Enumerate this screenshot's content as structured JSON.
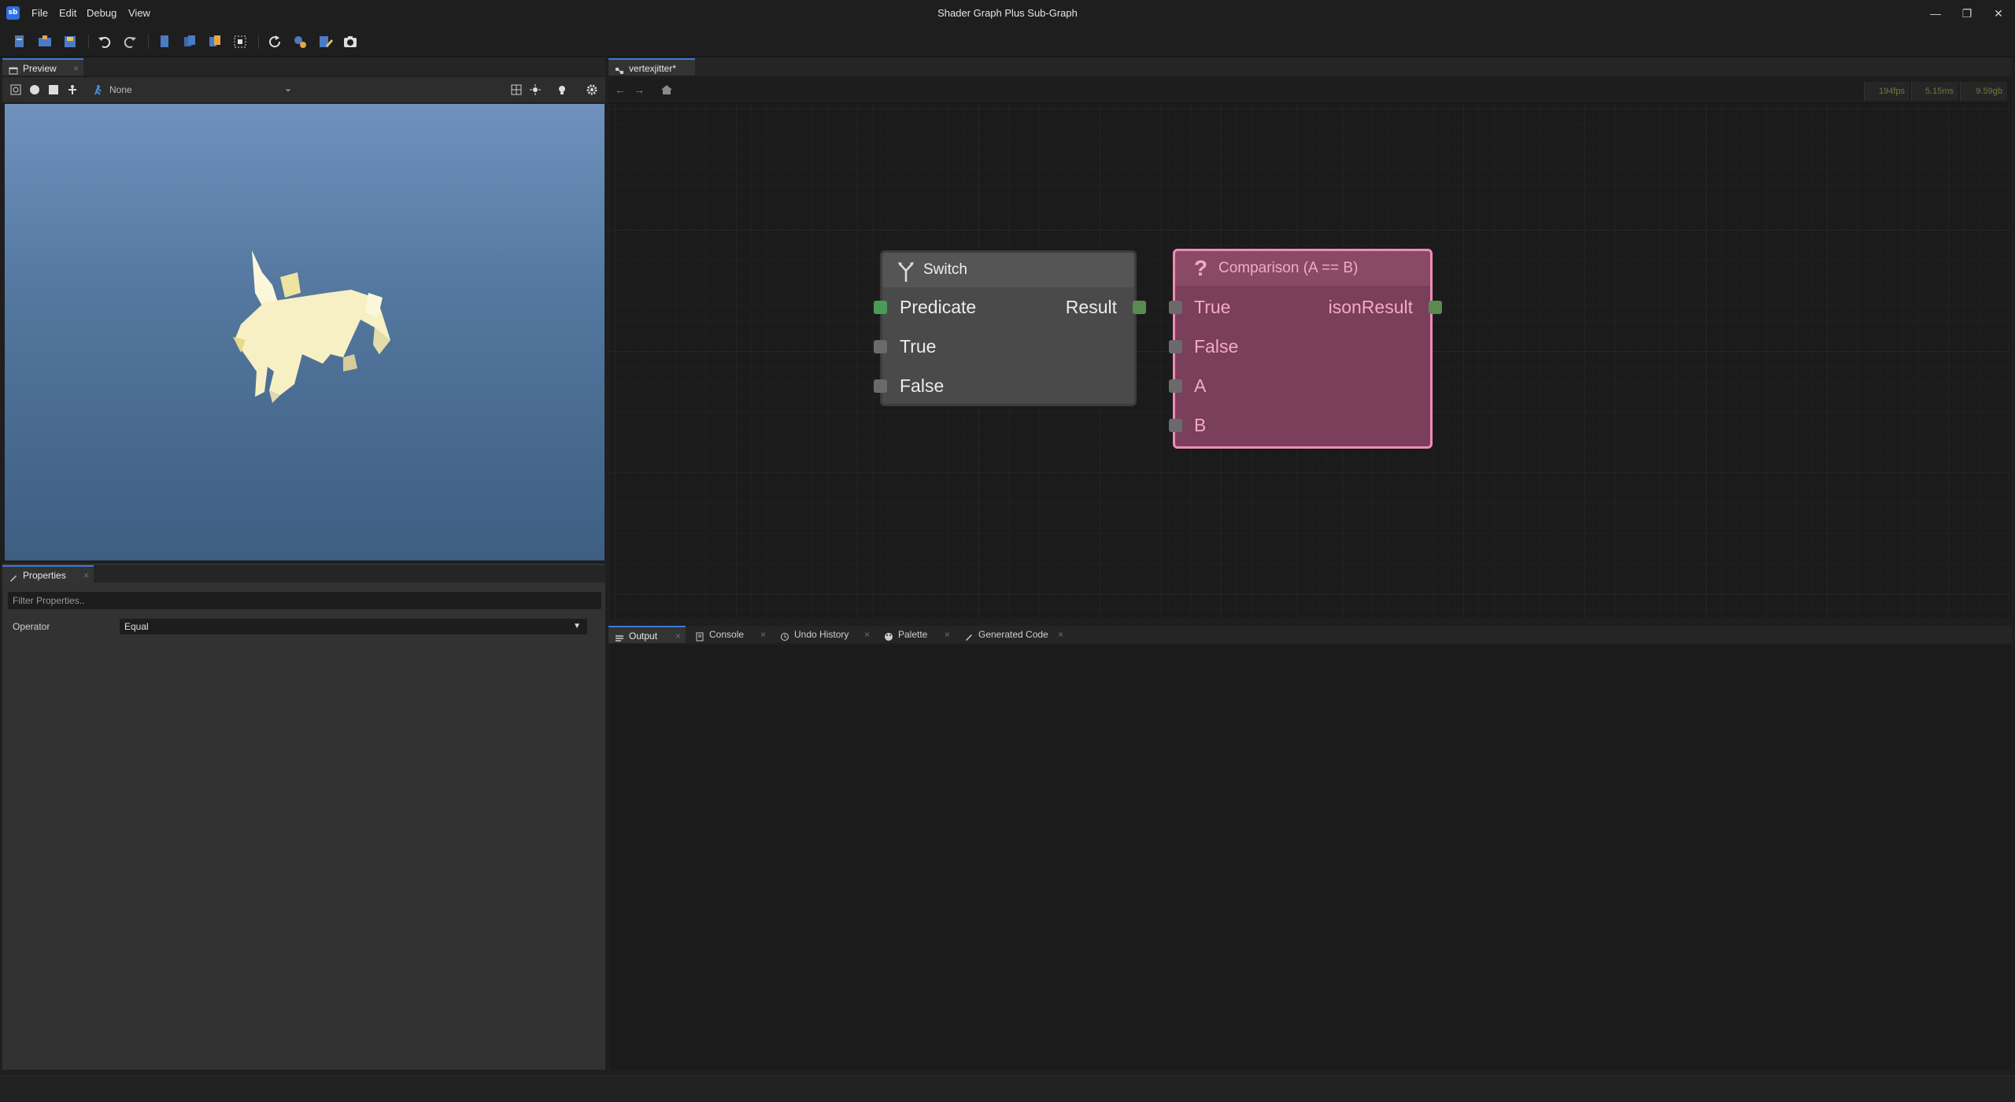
{
  "window": {
    "title": "Shader Graph Plus Sub-Graph",
    "logo": "sb",
    "minimize": "—",
    "restore": "❐",
    "close": "✕"
  },
  "menu": [
    "File",
    "Edit",
    "Debug",
    "View"
  ],
  "toolbar": {
    "icons": [
      "new-file-icon",
      "open-folder-icon",
      "save-icon",
      "undo-icon",
      "redo-icon",
      "page-icon",
      "copy-icon",
      "paste-icon",
      "select-icon",
      "refresh-icon",
      "settings-icon",
      "edit-icon",
      "camera-icon"
    ]
  },
  "preview": {
    "tab_label": "Preview",
    "model_dropdown": "None"
  },
  "properties": {
    "tab_label": "Properties",
    "filter_placeholder": "Filter Properties..",
    "operator_label": "Operator",
    "operator_value": "Equal"
  },
  "graph": {
    "tab_label": "vertexjitter*",
    "stats": [
      "194fps",
      "5.15ms",
      "9.59gb"
    ],
    "nodes": {
      "switch": {
        "title": "Switch",
        "inputs": [
          "Predicate",
          "True",
          "False"
        ],
        "output": "Result"
      },
      "comparison": {
        "title": "Comparison (A == B)",
        "inputs": [
          "True",
          "False",
          "A",
          "B"
        ],
        "output": "isonResult"
      }
    }
  },
  "bottom_tabs": [
    {
      "label": "Output"
    },
    {
      "label": "Console"
    },
    {
      "label": "Undo History"
    },
    {
      "label": "Palette"
    },
    {
      "label": "Generated Code"
    }
  ],
  "colors": {
    "accent": "#3a7bd5",
    "switch_node": "#4a4a4a",
    "comparison_node": "#7a3f5a",
    "comparison_border": "#f08ab8",
    "bool_port": "#4a9a5a",
    "default_port": "#6a6a6a"
  }
}
